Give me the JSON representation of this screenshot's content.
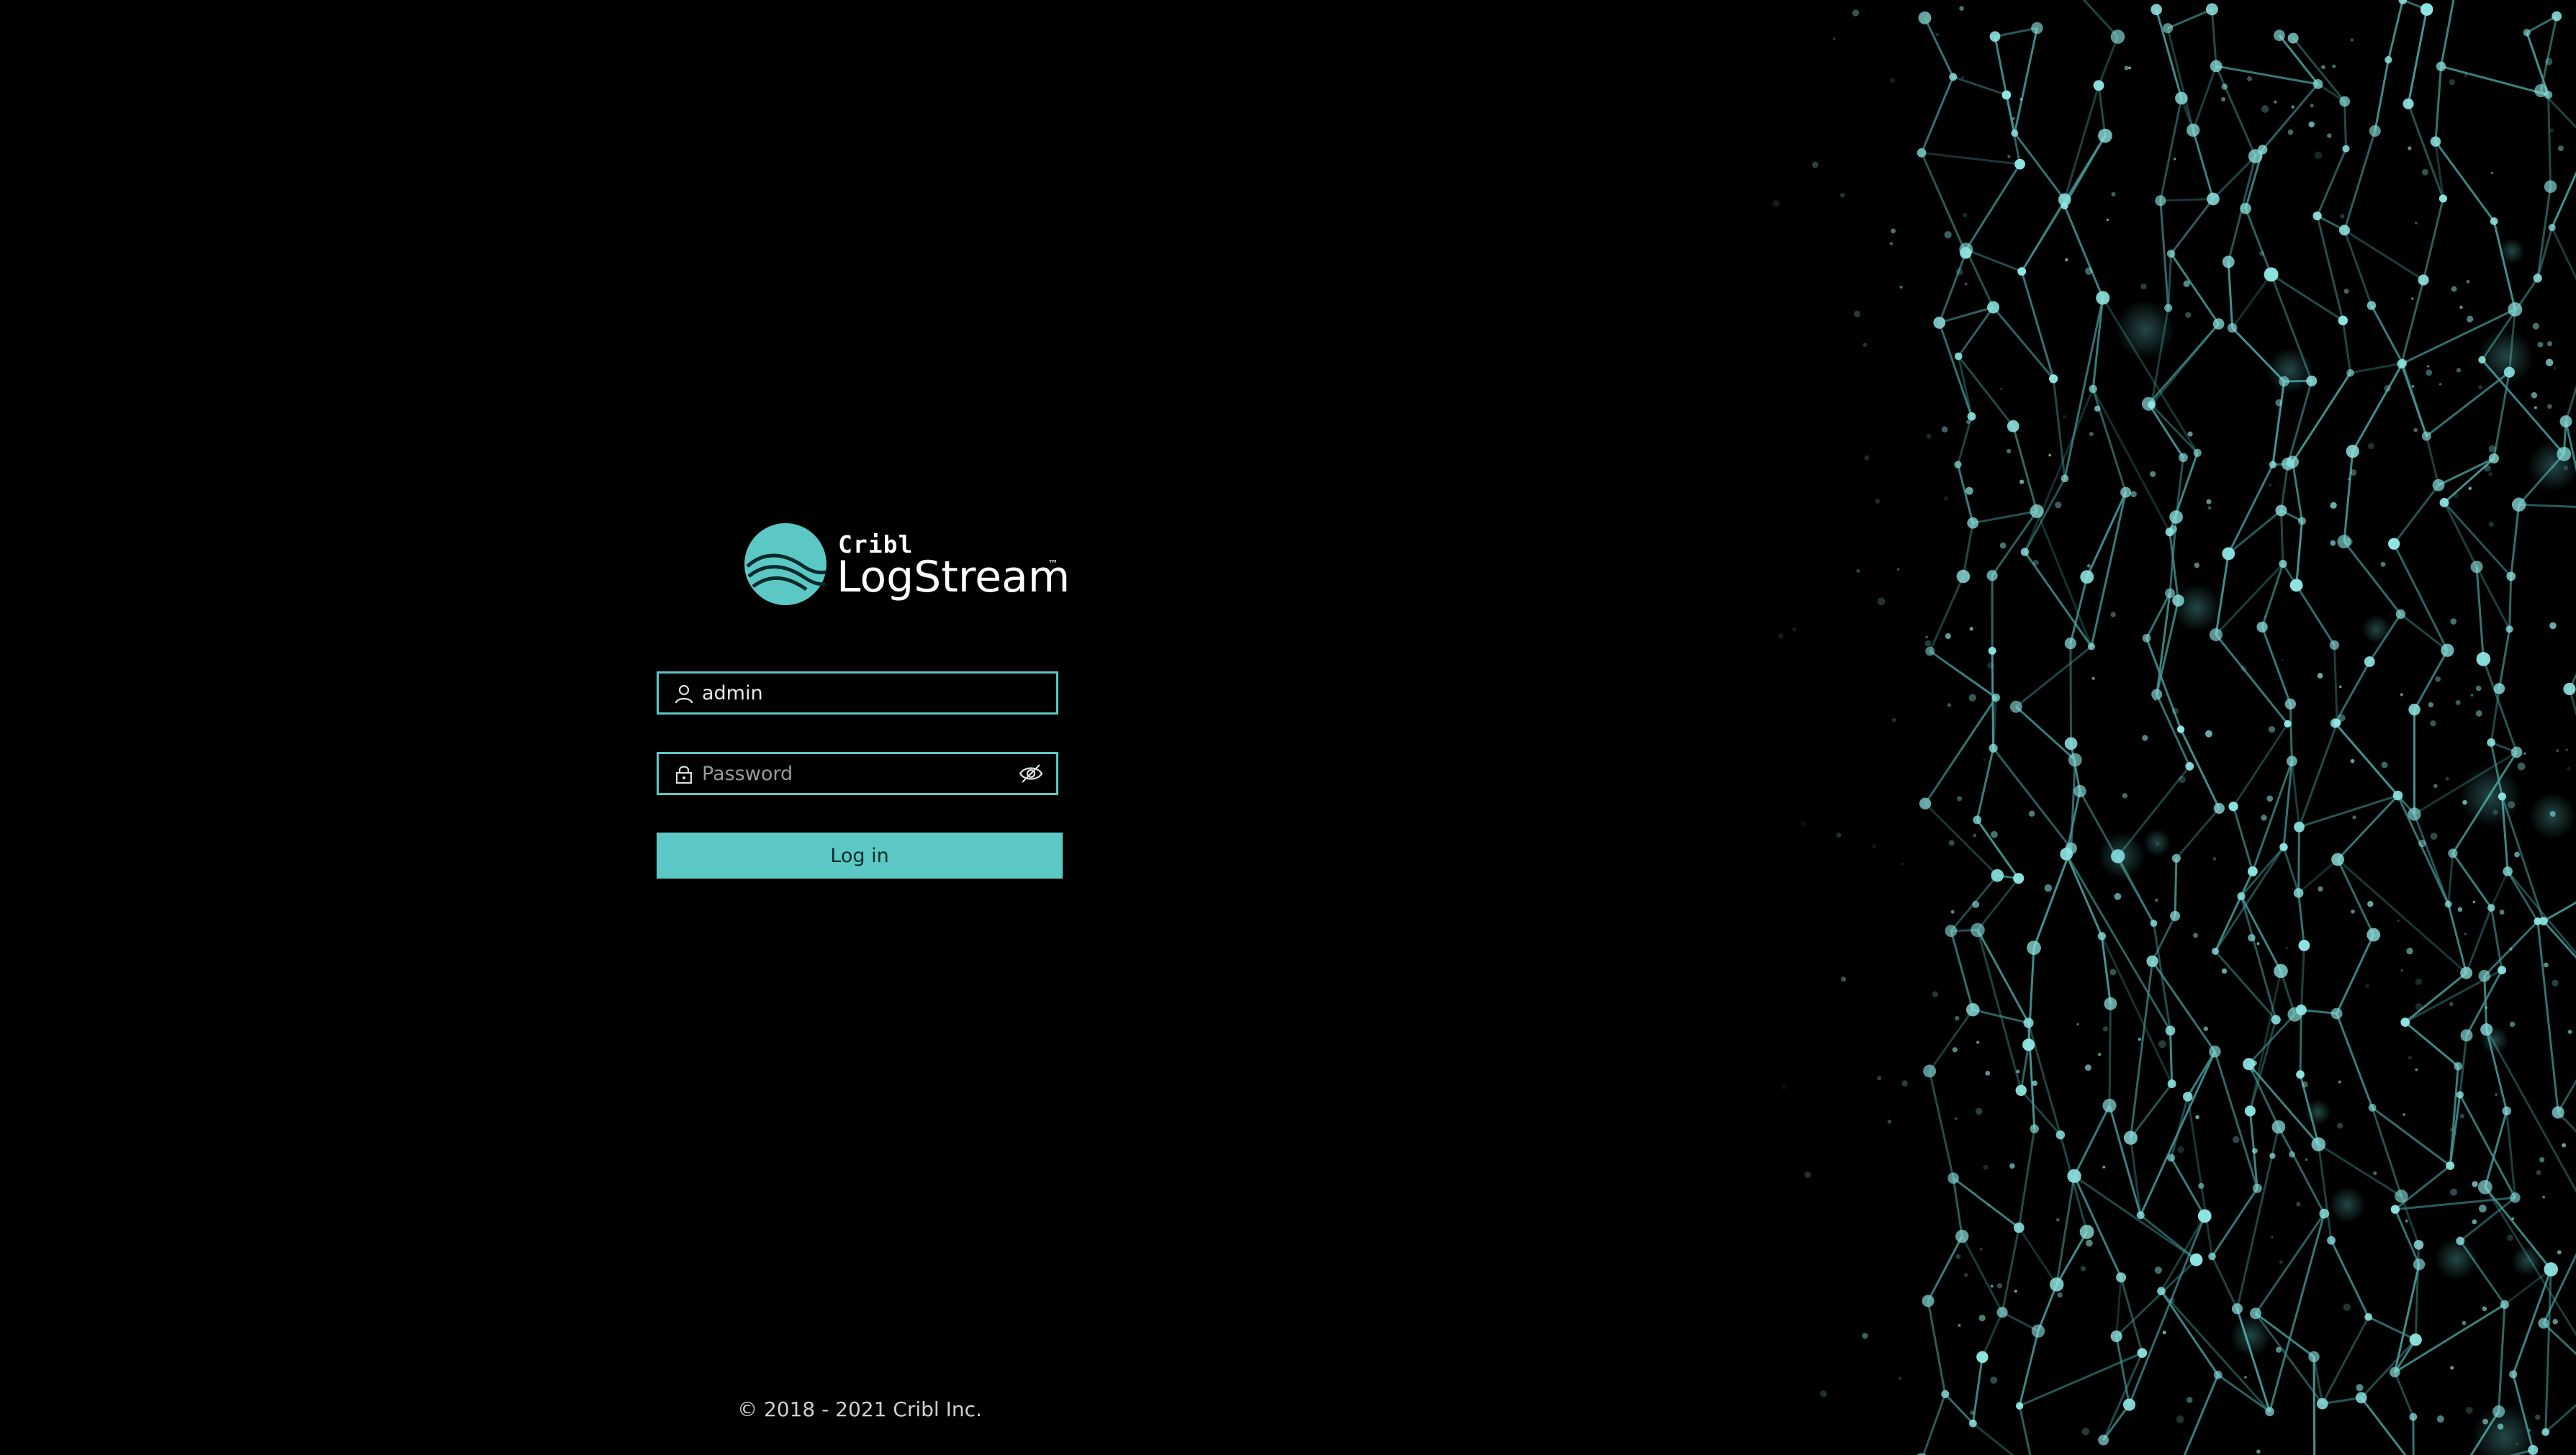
{
  "brand": {
    "company": "Cribl",
    "product": "LogStream",
    "trademark": "™",
    "accent_color": "#5bc8c6"
  },
  "login": {
    "username": {
      "value": "admin",
      "icon": "user-icon"
    },
    "password": {
      "value": "",
      "placeholder": "Password",
      "icon": "lock-icon",
      "toggle_icon": "eye-slash-icon"
    },
    "submit_label": "Log in"
  },
  "footer": {
    "copyright": "© 2018 - 2021 Cribl Inc."
  }
}
